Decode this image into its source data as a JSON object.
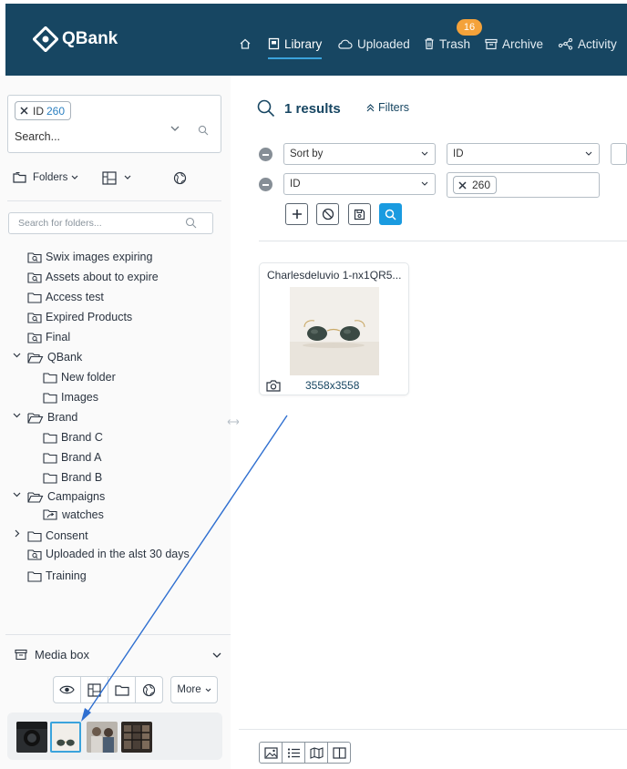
{
  "brand": {
    "name": "QBank"
  },
  "nav": {
    "home_icon": "home-icon",
    "items": [
      {
        "label": "Library",
        "icon": "library-icon",
        "active": true
      },
      {
        "label": "Uploaded",
        "icon": "cloud-icon"
      },
      {
        "label": "Trash",
        "icon": "trash-icon",
        "badge": "16"
      },
      {
        "label": "Archive",
        "icon": "archive-icon"
      },
      {
        "label": "Activity",
        "icon": "activity-icon"
      }
    ]
  },
  "search": {
    "chip_label": "ID",
    "chip_value": "260",
    "placeholder": "Search..."
  },
  "folders_toolbar": {
    "folders_label": "Folders"
  },
  "folder_search": {
    "placeholder": "Search for folders..."
  },
  "folders": [
    {
      "label": "Swix images expiring",
      "type": "smart"
    },
    {
      "label": "Assets about to expire",
      "type": "smart"
    },
    {
      "label": "Access test",
      "type": "folder"
    },
    {
      "label": "Expired Products",
      "type": "smart"
    },
    {
      "label": "Final",
      "type": "smart"
    },
    {
      "label": "QBank",
      "type": "open",
      "expanded": true
    },
    {
      "label": "New folder",
      "type": "folder"
    },
    {
      "label": "Images",
      "type": "folder"
    },
    {
      "label": "Brand",
      "type": "open",
      "expanded": true
    },
    {
      "label": "Brand C",
      "type": "folder"
    },
    {
      "label": "Brand A",
      "type": "folder"
    },
    {
      "label": "Brand B",
      "type": "folder"
    },
    {
      "label": "Campaigns",
      "type": "open",
      "expanded": true
    },
    {
      "label": "watches",
      "type": "shared"
    },
    {
      "label": "Consent",
      "type": "folder",
      "expanded": false
    },
    {
      "label": "Uploaded in the alst 30 days",
      "type": "smart"
    },
    {
      "label": "Training",
      "type": "folder"
    }
  ],
  "media_box": {
    "title": "Media box",
    "more_label": "More",
    "thumbnails": [
      "dark-product-photo",
      "sunglasses-photo",
      "people-photo",
      "store-photo"
    ],
    "selected_index": 1
  },
  "results": {
    "title": "1 results",
    "filters_label": "Filters"
  },
  "filter_rows": [
    {
      "field": "Sort by",
      "value": "ID"
    },
    {
      "field": "ID",
      "chip": "260"
    }
  ],
  "asset_card": {
    "title": "Charlesdeluvio 1-nx1QR5...",
    "dimensions": "3558x3558"
  },
  "colors": {
    "topbar": "#174662",
    "accent": "#1a9be0",
    "badge": "#f4a23a"
  }
}
